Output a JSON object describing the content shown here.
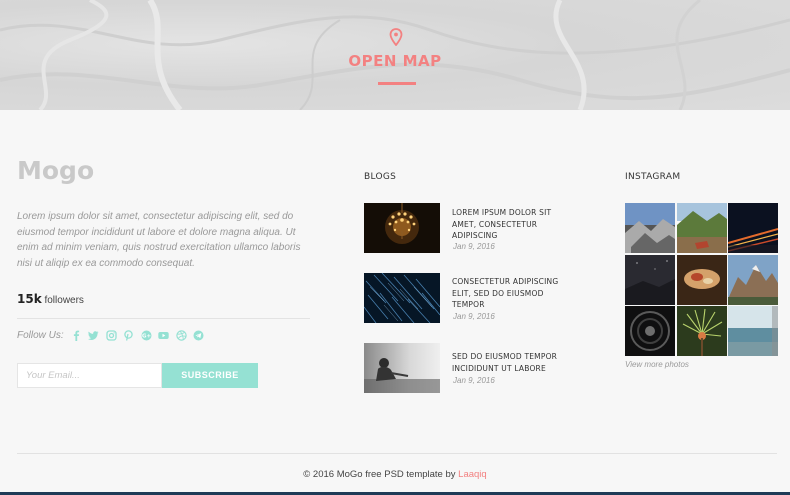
{
  "map": {
    "icon": "map-pin-icon",
    "title": "OPEN MAP",
    "accent": "#f38181"
  },
  "about": {
    "logo": "Mogo",
    "text": "Lorem ipsum dolor sit amet, consectetur adipiscing elit, sed do eiusmod tempor incididunt ut labore et dolore magna aliqua. Ut enim ad minim veniam, quis nostrud exercitation ullamco laboris nisi ut aliqip ex ea commodo consequat.",
    "followers_count": "15k",
    "followers_label": "followers",
    "follow_label": "Follow Us:",
    "social_icons": [
      "facebook-icon",
      "twitter-icon",
      "instagram-icon",
      "pinterest-icon",
      "google-plus-icon",
      "youtube-icon",
      "dribbble-icon",
      "telegram-icon"
    ],
    "social_color": "#95e1d3"
  },
  "subscribe": {
    "placeholder": "Your Email...",
    "button_label": "SUBSCRIBE",
    "button_color": "#95e1d3"
  },
  "blogs": {
    "heading": "BLOGS",
    "posts": [
      {
        "title": "LOREM IPSUM DOLOR SIT AMET, CONSECTETUR ADIPISCING",
        "date": "Jan 9, 2016"
      },
      {
        "title": "CONSECTETUR ADIPISCING ELIT, SED DO EIUSMOD TEMPOR",
        "date": "Jan 9, 2016"
      },
      {
        "title": "SED DO EIUSMOD TEMPOR INCIDIDUNT UT LABORE",
        "date": "Jan 9, 2016"
      }
    ]
  },
  "instagram": {
    "heading": "INSTAGRAM",
    "view_more": "View more photos"
  },
  "footer": {
    "copyright": "© 2016 MoGo free PSD template by",
    "author": "Laaqiq"
  }
}
